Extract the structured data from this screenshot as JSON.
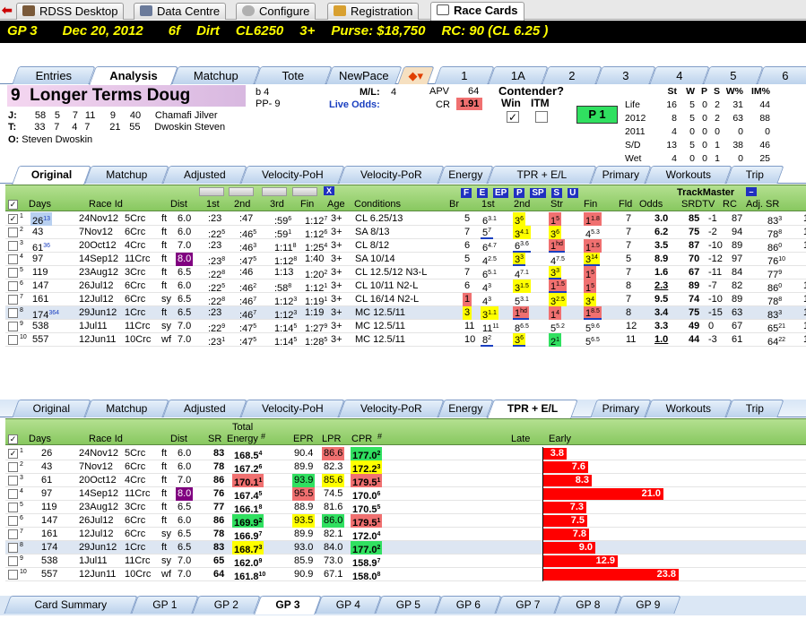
{
  "app_tabs": [
    {
      "label": "RDSS Desktop"
    },
    {
      "label": "Data Centre"
    },
    {
      "label": "Configure"
    },
    {
      "label": "Registration"
    },
    {
      "label": "Race Cards"
    }
  ],
  "race_header": {
    "race": "GP 3",
    "date": "Dec 20, 2012",
    "distance": "6f",
    "surface": "Dirt",
    "class": "CL6250",
    "age": "3+",
    "purse": "Purse: $18,750",
    "rc": "RC: 90 (CL 6.25 )"
  },
  "section_tabs": [
    {
      "label": "Entries"
    },
    {
      "label": "Analysis"
    },
    {
      "label": "Matchup"
    },
    {
      "label": "Tote"
    },
    {
      "label": "NewPace"
    },
    {
      "label": "1"
    },
    {
      "label": "1A"
    },
    {
      "label": "2"
    },
    {
      "label": "3"
    },
    {
      "label": "4"
    },
    {
      "label": "5"
    },
    {
      "label": "6"
    }
  ],
  "horse": {
    "number": "9",
    "name": "Longer Terms Doug",
    "sex_age": "b 4",
    "pp": "PP- 9",
    "ml_label": "M/L:",
    "ml_value": "4",
    "live_odds_label": "Live Odds:",
    "apv_label": "APV",
    "apv_value": "64",
    "cr_label": "CR",
    "cr_value": "1.91",
    "contender_label": "Contender?",
    "win_label": "Win",
    "itm_label": "ITM",
    "win_checked": "✓",
    "p_badge": "P 1",
    "jockey": {
      "label": "J:",
      "stats": [
        "58",
        "5",
        "7",
        "11",
        "9",
        "40"
      ],
      "name": "Chamafi Jilver"
    },
    "trainer": {
      "label": "T:",
      "stats": [
        "33",
        "7",
        "4",
        "7",
        "21",
        "55"
      ],
      "name": "Dwoskin Steven"
    },
    "owner": {
      "label": "O:",
      "name": "Steven Dwoskin"
    }
  },
  "record": {
    "headers": [
      "St",
      "W",
      "P",
      "S",
      "W%",
      "IM%"
    ],
    "rows": [
      {
        "label": "Life",
        "vals": [
          "16",
          "5",
          "0",
          "2",
          "31",
          "44"
        ]
      },
      {
        "label": "2012",
        "vals": [
          "8",
          "5",
          "0",
          "2",
          "63",
          "88"
        ]
      },
      {
        "label": "2011",
        "vals": [
          "4",
          "0",
          "0",
          "0",
          "0",
          "0"
        ]
      },
      {
        "label": "S/D",
        "vals": [
          "13",
          "5",
          "0",
          "1",
          "38",
          "46"
        ]
      },
      {
        "label": "Wet",
        "vals": [
          "4",
          "0",
          "0",
          "1",
          "0",
          "25"
        ]
      }
    ]
  },
  "sub_tabs": [
    {
      "label": "Original"
    },
    {
      "label": "Matchup"
    },
    {
      "label": "Adjusted"
    },
    {
      "label": "Velocity-PoH"
    },
    {
      "label": "Velocity-PoR"
    },
    {
      "label": "Energy"
    },
    {
      "label": "TPR + E/L"
    },
    {
      "label": "Primary"
    },
    {
      "label": "Workouts"
    },
    {
      "label": "Trip"
    }
  ],
  "top_grid": {
    "headers": {
      "days": "Days",
      "race_id": "Race Id",
      "dist": "Dist",
      "c1": "1st",
      "c2": "2nd",
      "c3": "3rd",
      "fin": "Fin",
      "age": "Age",
      "conditions": "Conditions",
      "br": "Br",
      "first": "1st",
      "second": "2nd",
      "str": "Str",
      "fin2": "Fin",
      "fld": "Fld",
      "odds": "Odds",
      "srdtv": "SRDTV",
      "rc": "RC",
      "adjsr": "Adj. SR",
      "trackmaster": "TrackMaster",
      "x_btn": "X",
      "col_letters": [
        "F",
        "E",
        "EP",
        "P",
        "SP",
        "S",
        "U"
      ]
    },
    "rows": [
      {
        "n": "1",
        "days": "26",
        "sup": "13",
        "date": "24Nov12",
        "race": "5Crc",
        "surf": "ft",
        "dist": "6.0",
        "c1": ":23",
        "c2": ":47",
        "c3": ":59",
        "c3s": "6",
        "fin": "1:12",
        "fins": "7",
        "age": "3+",
        "cond": "CL 6.25/13",
        "br": "5",
        "p1": "6",
        "p1s": "3.1",
        "p2": "3",
        "p2s": "6",
        "str": "1",
        "strs": "5",
        "f": "1",
        "fs": "1.8",
        "fld": "7",
        "odds": "3.0",
        "sr": "85",
        "dtv": "-1",
        "rc": "87",
        "adj": "83",
        "adjs": "3",
        "last": "1"
      },
      {
        "n": "2",
        "days": "43",
        "sup": "",
        "date": "7Nov12",
        "race": "6Crc",
        "surf": "ft",
        "dist": "6.0",
        "c1": ":22",
        "c1s": "5",
        "c2": ":46",
        "c2s": "5",
        "c3": ":59",
        "c3s": "1",
        "fin": "1:12",
        "fins": "6",
        "age": "3+",
        "cond": "SA 8/13",
        "br": "7",
        "p1": "5",
        "p1s": "7",
        "p2": "3",
        "p2s": "4.1",
        "str": "3",
        "strs": "6",
        "f": "4",
        "fs": "5.3",
        "fld": "7",
        "odds": "6.2",
        "sr": "75",
        "dtv": "-2",
        "rc": "94",
        "adj": "78",
        "adjs": "8",
        "last": "1"
      },
      {
        "n": "3",
        "days": "61",
        "sup": "36",
        "date": "20Oct12",
        "race": "4Crc",
        "surf": "ft",
        "dist": "7.0",
        "c1": ":23",
        "c2": ":46",
        "c2s": "3",
        "c3": "1:11",
        "c3s": "8",
        "fin": "1:25",
        "fins": "4",
        "age": "3+",
        "cond": "CL 8/12",
        "br": "6",
        "p1": "6",
        "p1s": "4.7",
        "p2": "6",
        "p2s": "3.6",
        "str": "1",
        "strs": "hd",
        "f": "1",
        "fs": "1.5",
        "fld": "7",
        "odds": "3.5",
        "sr": "87",
        "dtv": "-10",
        "rc": "89",
        "adj": "86",
        "adjs": "0",
        "last": "1"
      },
      {
        "n": "4",
        "days": "97",
        "sup": "",
        "date": "14Sep12",
        "race": "11Crc",
        "surf": "ft",
        "dist": "8.0",
        "c1": ":23",
        "c1s": "8",
        "c2": ":47",
        "c2s": "5",
        "c3": "1:12",
        "c3s": "8",
        "fin": "1:40",
        "fins": "",
        "age": "3+",
        "cond": "SA 10/14",
        "br": "5",
        "p1": "4",
        "p1s": "2.5",
        "p2": "3",
        "p2s": "3",
        "str": "4",
        "strs": "7.5",
        "f": "3",
        "fs": "14",
        "fld": "5",
        "odds": "8.9",
        "sr": "70",
        "dtv": "-12",
        "rc": "97",
        "adj": "76",
        "adjs": "10",
        "last": ""
      },
      {
        "n": "5",
        "days": "119",
        "sup": "",
        "date": "23Aug12",
        "race": "3Crc",
        "surf": "ft",
        "dist": "6.5",
        "c1": ":22",
        "c1s": "8",
        "c2": ":46",
        "c3": "1:13",
        "c3s": "",
        "fin": "1:20",
        "fins": "2",
        "age": "3+",
        "cond": "CL 12.5/12 N3-L",
        "br": "7",
        "p1": "6",
        "p1s": "5.1",
        "p2": "4",
        "p2s": "7.1",
        "str": "3",
        "strs": "3",
        "f": "1",
        "fs": "5",
        "fld": "7",
        "odds": "1.6",
        "sr": "67",
        "dtv": "-11",
        "rc": "84",
        "adj": "77",
        "adjs": "9",
        "last": ""
      },
      {
        "n": "6",
        "days": "147",
        "sup": "",
        "date": "26Jul12",
        "race": "6Crc",
        "surf": "ft",
        "dist": "6.0",
        "c1": ":22",
        "c1s": "5",
        "c2": ":46",
        "c2s": "2",
        "c3": ":58",
        "c3s": "8",
        "fin": "1:12",
        "fins": "1",
        "age": "3+",
        "cond": "CL 10/11 N2-L",
        "br": "6",
        "p1": "4",
        "p1s": "3",
        "p2": "3",
        "p2s": "1.5",
        "str": "1",
        "strs": "1.5",
        "f": "1",
        "fs": "5",
        "fld": "8",
        "odds": "2.3",
        "sr": "89",
        "dtv": "-7",
        "rc": "82",
        "adj": "86",
        "adjs": "0",
        "last": "1"
      },
      {
        "n": "7",
        "days": "161",
        "sup": "",
        "date": "12Jul12",
        "race": "6Crc",
        "surf": "sy",
        "dist": "6.5",
        "c1": ":22",
        "c1s": "8",
        "c2": ":46",
        "c2s": "7",
        "c3": "1:12",
        "c3s": "3",
        "fin": "1:19",
        "fins": "1",
        "age": "3+",
        "cond": "CL 16/14 N2-L",
        "br": "1",
        "p1": "4",
        "p1s": "3",
        "p2": "5",
        "p2s": "3.1",
        "str": "3",
        "strs": "2.5",
        "f": "3",
        "fs": "4",
        "fld": "7",
        "odds": "9.5",
        "sr": "74",
        "dtv": "-10",
        "rc": "89",
        "adj": "78",
        "adjs": "8",
        "last": "1"
      },
      {
        "n": "8",
        "days": "174",
        "sup": "364",
        "date": "29Jun12",
        "race": "1Crc",
        "surf": "ft",
        "dist": "6.5",
        "c1": ":23",
        "c2": ":46",
        "c2s": "7",
        "c3": "1:12",
        "c3s": "3",
        "fin": "1:19",
        "fins": "",
        "age": "3+",
        "cond": "MC 12.5/11",
        "br": "3",
        "p1": "3",
        "p1s": "1.1",
        "p2": "1",
        "p2s": "hd",
        "str": "1",
        "strs": "4",
        "f": "1",
        "fs": "8.5",
        "fld": "8",
        "odds": "3.4",
        "sr": "75",
        "dtv": "-15",
        "rc": "63",
        "adj": "83",
        "adjs": "3",
        "last": "1"
      },
      {
        "n": "9",
        "days": "538",
        "sup": "",
        "date": "1Jul11",
        "race": "11Crc",
        "surf": "sy",
        "dist": "7.0",
        "c1": ":22",
        "c1s": "9",
        "c2": ":47",
        "c2s": "5",
        "c3": "1:14",
        "c3s": "5",
        "fin": "1:27",
        "fins": "9",
        "age": "3+",
        "cond": "MC 12.5/11",
        "br": "11",
        "p1": "11",
        "p1s": "11",
        "p2": "8",
        "p2s": "6.5",
        "str": "5",
        "strs": "5.2",
        "f": "5",
        "fs": "9.6",
        "fld": "12",
        "odds": "3.3",
        "sr": "49",
        "dtv": "0",
        "rc": "67",
        "adj": "65",
        "adjs": "21",
        "last": "1"
      },
      {
        "n": "10",
        "days": "557",
        "sup": "",
        "date": "12Jun11",
        "race": "10Crc",
        "surf": "wf",
        "dist": "7.0",
        "c1": ":23",
        "c1s": "1",
        "c2": ":47",
        "c2s": "5",
        "c3": "1:14",
        "c3s": "5",
        "fin": "1:28",
        "fins": "5",
        "age": "3+",
        "cond": "MC 12.5/11",
        "br": "10",
        "p1": "8",
        "p1s": "2",
        "p2": "3",
        "p2s": "6",
        "str": "2",
        "strs": "1",
        "f": "5",
        "fs": "6.5",
        "fld": "11",
        "odds": "1.0",
        "sr": "44",
        "dtv": "-3",
        "rc": "61",
        "adj": "64",
        "adjs": "22",
        "last": "1"
      }
    ]
  },
  "bottom_tabs": [
    {
      "label": "Original"
    },
    {
      "label": "Matchup"
    },
    {
      "label": "Adjusted"
    },
    {
      "label": "Velocity-PoH"
    },
    {
      "label": "Velocity-PoR"
    },
    {
      "label": "Energy"
    },
    {
      "label": "TPR + E/L"
    },
    {
      "label": "Primary"
    },
    {
      "label": "Workouts"
    },
    {
      "label": "Trip"
    }
  ],
  "bottom_grid": {
    "headers": {
      "days": "Days",
      "race_id": "Race Id",
      "dist": "Dist",
      "sr": "SR",
      "total_energy_top": "Total",
      "total_energy": "Energy",
      "hash": "#",
      "epr": "EPR",
      "lpr": "LPR",
      "cpr": "CPR",
      "hash2": "#",
      "late": "Late",
      "early": "Early"
    },
    "rows": [
      {
        "n": "1",
        "days": "26",
        "date": "24Nov12",
        "race": "5Crc",
        "surf": "ft",
        "dist": "6.0",
        "sr": "83",
        "te": "168.5",
        "tes": "4",
        "epr": "90.4",
        "lpr": "86.6",
        "cpr": "177.0",
        "cprs": "2",
        "early": 3.8,
        "early_label": "3.8"
      },
      {
        "n": "2",
        "days": "43",
        "date": "7Nov12",
        "race": "6Crc",
        "surf": "ft",
        "dist": "6.0",
        "sr": "78",
        "te": "167.2",
        "tes": "6",
        "epr": "89.9",
        "lpr": "82.3",
        "cpr": "172.2",
        "cprs": "3",
        "early": 7.6,
        "early_label": "7.6"
      },
      {
        "n": "3",
        "days": "61",
        "date": "20Oct12",
        "race": "4Crc",
        "surf": "ft",
        "dist": "7.0",
        "sr": "86",
        "te": "170.1",
        "tes": "1",
        "epr": "93.9",
        "lpr": "85.6",
        "cpr": "179.5",
        "cprs": "1",
        "early": 8.3,
        "early_label": "8.3"
      },
      {
        "n": "4",
        "days": "97",
        "date": "14Sep12",
        "race": "11Crc",
        "surf": "ft",
        "dist": "8.0",
        "sr": "76",
        "te": "167.4",
        "tes": "5",
        "epr": "95.5",
        "lpr": "74.5",
        "cpr": "170.0",
        "cprs": "6",
        "early": 21.0,
        "early_label": "21.0"
      },
      {
        "n": "5",
        "days": "119",
        "date": "23Aug12",
        "race": "3Crc",
        "surf": "ft",
        "dist": "6.5",
        "sr": "77",
        "te": "166.1",
        "tes": "8",
        "epr": "88.9",
        "lpr": "81.6",
        "cpr": "170.5",
        "cprs": "5",
        "early": 7.3,
        "early_label": "7.3"
      },
      {
        "n": "6",
        "days": "147",
        "date": "26Jul12",
        "race": "6Crc",
        "surf": "ft",
        "dist": "6.0",
        "sr": "86",
        "te": "169.9",
        "tes": "2",
        "epr": "93.5",
        "lpr": "86.0",
        "cpr": "179.5",
        "cprs": "1",
        "early": 7.5,
        "early_label": "7.5"
      },
      {
        "n": "7",
        "days": "161",
        "date": "12Jul12",
        "race": "6Crc",
        "surf": "sy",
        "dist": "6.5",
        "sr": "78",
        "te": "166.9",
        "tes": "7",
        "epr": "89.9",
        "lpr": "82.1",
        "cpr": "172.0",
        "cprs": "4",
        "early": 7.8,
        "early_label": "7.8"
      },
      {
        "n": "8",
        "days": "174",
        "date": "29Jun12",
        "race": "1Crc",
        "surf": "ft",
        "dist": "6.5",
        "sr": "83",
        "te": "168.7",
        "tes": "3",
        "epr": "93.0",
        "lpr": "84.0",
        "cpr": "177.0",
        "cprs": "2",
        "early": 9.0,
        "early_label": "9.0"
      },
      {
        "n": "9",
        "days": "538",
        "date": "1Jul11",
        "race": "11Crc",
        "surf": "sy",
        "dist": "7.0",
        "sr": "65",
        "te": "162.0",
        "tes": "9",
        "epr": "85.9",
        "lpr": "73.0",
        "cpr": "158.9",
        "cprs": "7",
        "early": 12.9,
        "early_label": "12.9"
      },
      {
        "n": "10",
        "days": "557",
        "date": "12Jun11",
        "race": "10Crc",
        "surf": "wf",
        "dist": "7.0",
        "sr": "64",
        "te": "161.8",
        "tes": "10",
        "epr": "90.9",
        "lpr": "67.1",
        "cpr": "158.0",
        "cprs": "8",
        "early": 23.8,
        "early_label": "23.8"
      }
    ]
  },
  "footer_tabs": [
    {
      "label": "Card Summary"
    },
    {
      "label": "GP 1"
    },
    {
      "label": "GP 2"
    },
    {
      "label": "GP 3"
    },
    {
      "label": "GP 4"
    },
    {
      "label": "GP 5"
    },
    {
      "label": "GP 6"
    },
    {
      "label": "GP 7"
    },
    {
      "label": "GP 8"
    },
    {
      "label": "GP 9"
    }
  ],
  "colors": {
    "red": "#f07070",
    "yellow": "#ffff00",
    "green": "#30e060",
    "purple": "#800080",
    "bar": "#ff0000"
  }
}
